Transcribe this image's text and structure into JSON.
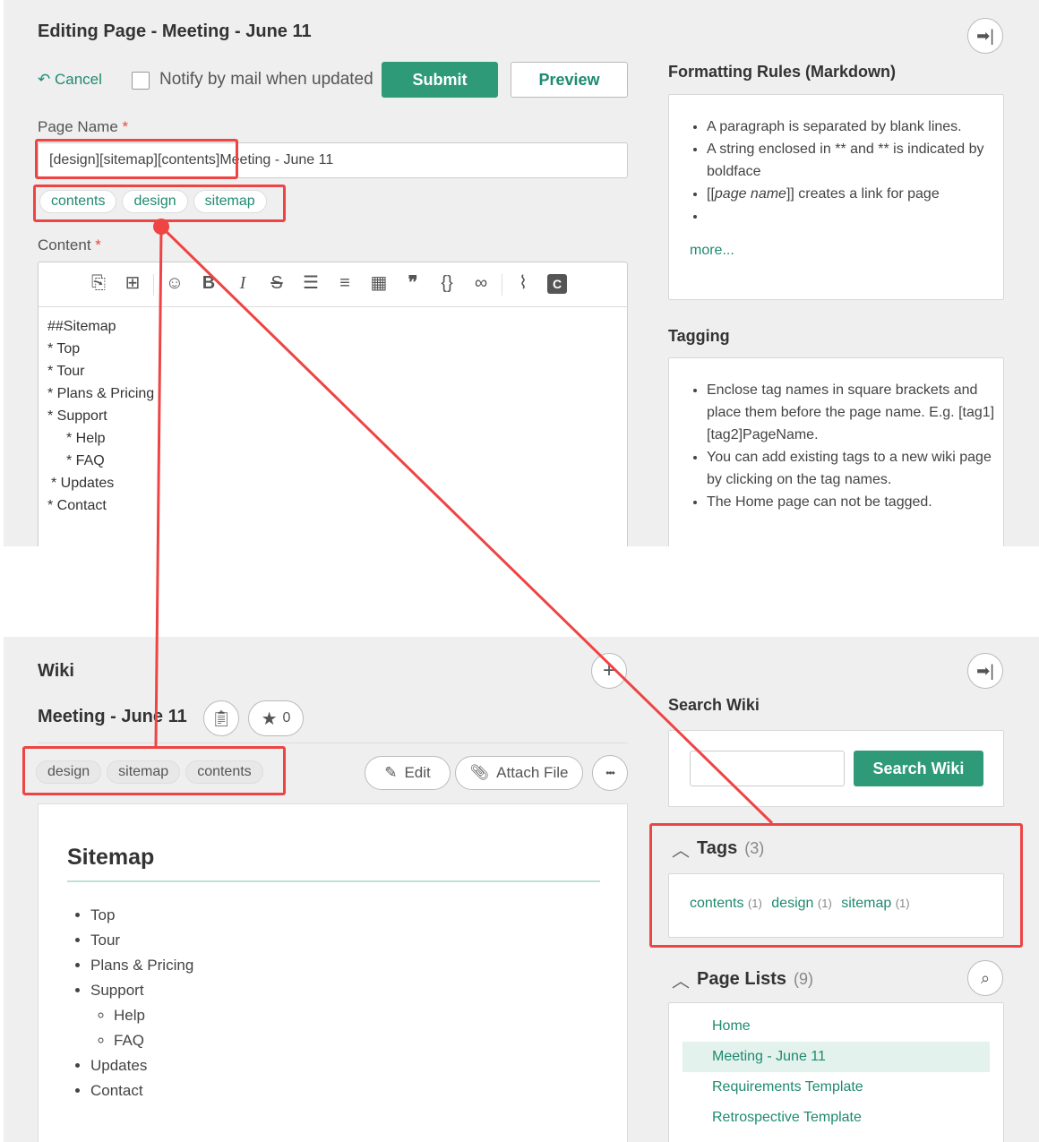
{
  "edit": {
    "title": "Editing Page - Meeting - June 11",
    "cancel": "Cancel",
    "notify": "Notify by mail when updated",
    "submit": "Submit",
    "preview": "Preview",
    "page_name_label": "Page Name",
    "required": "*",
    "page_name_value": "[design][sitemap][contents]Meeting - June 11",
    "tags": [
      "contents",
      "design",
      "sitemap"
    ],
    "content_label": "Content",
    "content_lines": [
      "##Sitemap",
      "* Top",
      "* Tour",
      "* Plans & Pricing",
      "* Support",
      "   * Help",
      "   * FAQ",
      " * Updates",
      "* Contact"
    ],
    "rules_title": "Formatting Rules (Markdown)",
    "rules": [
      "A paragraph is separated by blank lines.",
      "A string enclosed in ** and ** is indicated by boldface",
      "[[",
      "page name",
      "]] creates a link for page",
      ""
    ],
    "more": "more...",
    "tagging_title": "Tagging",
    "tagging": [
      "Enclose tag names in square brackets and place them before the page name. E.g. [tag1][tag2]PageName.",
      "You can add existing tags to a new wiki page by clicking on the tag names.",
      "The Home page can not be tagged."
    ]
  },
  "wiki": {
    "title": "Wiki",
    "page_title": "Meeting - June 11",
    "star_count": "0",
    "tags": [
      "design",
      "sitemap",
      "contents"
    ],
    "edit": "Edit",
    "attach": "Attach File",
    "more_icon": "•••",
    "heading": "Sitemap",
    "items": [
      "Top",
      "Tour",
      "Plans & Pricing",
      "Support",
      "Updates",
      "Contact"
    ],
    "subitems": [
      "Help",
      "FAQ"
    ],
    "search_title": "Search Wiki",
    "search_button": "Search Wiki",
    "search_placeholder": "",
    "tags_title": "Tags",
    "tags_count": "(3)",
    "tag_counts": [
      {
        "name": "contents",
        "count": "(1)"
      },
      {
        "name": "design",
        "count": "(1)"
      },
      {
        "name": "sitemap",
        "count": "(1)"
      }
    ],
    "pagelists_title": "Page Lists",
    "pagelists_count": "(9)",
    "pages": [
      "Home",
      "Meeting - June 11",
      "Requirements Template",
      "Retrospective Template"
    ]
  },
  "colors": {
    "accent": "#2e9a78",
    "annotation": "#e44444"
  }
}
